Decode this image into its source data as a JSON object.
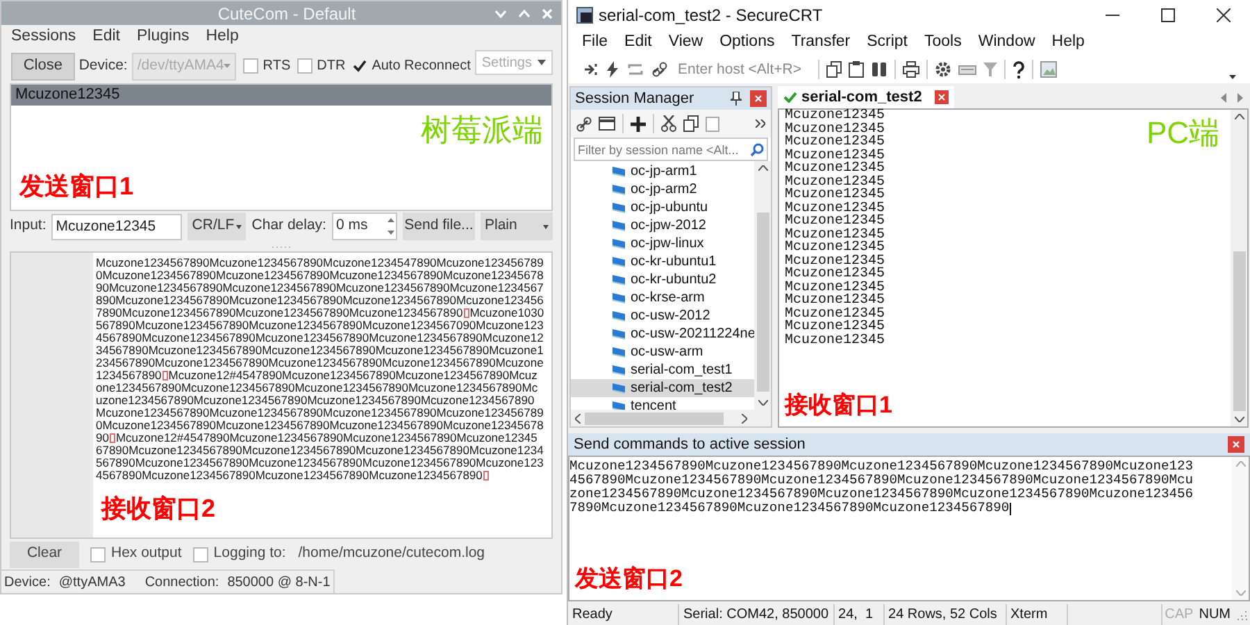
{
  "cutecom": {
    "window": {
      "title": "CuteCom - Default"
    },
    "menu": [
      "Sessions",
      "Edit",
      "Plugins",
      "Help"
    ],
    "toolbar": {
      "close_button": "Close",
      "device_label": "Device:",
      "device": {
        "value": "/dev/ttyAMA4",
        "disabled": true
      },
      "options": [
        {
          "label": "RTS",
          "checked": false
        },
        {
          "label": "DTR",
          "checked": false
        },
        {
          "label": "Auto Reconnect",
          "checked": true
        }
      ],
      "settings_button": "Settings"
    },
    "history": {
      "items": [
        {
          "text": "Mcuzone12345",
          "selected": true
        }
      ],
      "side_label": {
        "text": "树莓派端",
        "color": "#7ed400"
      },
      "area_label": {
        "text": "发送窗口1",
        "color": "#ff0000"
      }
    },
    "input_row": {
      "label": "Input:",
      "value": "Mcuzone12345",
      "line_end": "CR/LF",
      "delay_label": "Char delay:",
      "delay": "0 ms",
      "send_file_button": "Send file...",
      "format": "Plain"
    },
    "output": {
      "lines": [
        [
          {
            "kind": "text",
            "text": "Mcuzone1234567890Mcuzone1234567890Mcuzone1234547890Mcuzone123456789"
          }
        ],
        [
          {
            "kind": "text",
            "text": "0Mcuzone1234567890Mcuzone1234567890Mcuzone1234567890Mcuzone12345678"
          }
        ],
        [
          {
            "kind": "text",
            "text": "90Mcuzone1234567890Mcuzone1234567890Mcuzone1234567890Mcuzone1234567"
          }
        ],
        [
          {
            "kind": "text",
            "text": "890Mcuzone1234567890Mcuzone1234567890Mcuzone1234567890Mcuzone123456"
          }
        ],
        [
          {
            "kind": "text",
            "text": "7890Mcuzone1234567890Mcuzone1234567890Mcuzone1234567890"
          },
          {
            "kind": "missing_glyph"
          },
          {
            "kind": "text",
            "text": "Mcuzone1030"
          }
        ],
        [
          {
            "kind": "text",
            "text": "567890Mcuzone1234567890Mcuzone1234567890Mcuzone1234567090Mcuzone123"
          }
        ],
        [
          {
            "kind": "text",
            "text": "4567890Mcuzone1234567890Mcuzone1234567890Mcuzone1234567890Mcuzone12"
          }
        ],
        [
          {
            "kind": "text",
            "text": "34567890Mcuzone1234567890Mcuzone1234567890Mcuzone1234567890Mcuzone1"
          }
        ],
        [
          {
            "kind": "text",
            "text": "234567890Mcuzone1234567890Mcuzone1234567890Mcuzone1234567890Mcuzone"
          }
        ],
        [
          {
            "kind": "text",
            "text": "1234567890"
          },
          {
            "kind": "missing_glyph"
          },
          {
            "kind": "text",
            "text": "Mcuzone12#4547890Mcuzone1234567890Mcuzone1234567890Mcuz"
          }
        ],
        [
          {
            "kind": "text",
            "text": "one1234567890Mcuzone1234567890Mcuzone1234567890Mcuzone1234567890Mc"
          }
        ],
        [
          {
            "kind": "text",
            "text": "uzone1234567890Mcuzone1234567890Mcuzone1234567890Mcuzone1234567890"
          }
        ],
        [
          {
            "kind": "text",
            "text": "Mcuzone1234567890Mcuzone1234567890Mcuzone1234567890Mcuzone123456789"
          }
        ],
        [
          {
            "kind": "text",
            "text": "0Mcuzone1234567890Mcuzone1234567890Mcuzone1234567890Mcuzone12345678"
          }
        ],
        [
          {
            "kind": "text",
            "text": "90"
          },
          {
            "kind": "missing_glyph"
          },
          {
            "kind": "text",
            "text": "Mcuzone12#4547890Mcuzone1234567890Mcuzone1234567890Mcuzone12345"
          }
        ],
        [
          {
            "kind": "text",
            "text": "67890Mcuzone1234567890Mcuzone1234567890Mcuzone1234567890Mcuzone1234"
          }
        ],
        [
          {
            "kind": "text",
            "text": "567890Mcuzone1234567890Mcuzone1234567890Mcuzone1234567890Mcuzone123"
          }
        ],
        [
          {
            "kind": "text",
            "text": "4567890Mcuzone1234567890Mcuzone1234567890Mcuzone1234567890"
          },
          {
            "kind": "missing_glyph"
          }
        ]
      ],
      "area_label": {
        "text": "接收窗口2",
        "color": "#ff0000"
      }
    },
    "bottom": {
      "clear_button": "Clear",
      "options": [
        {
          "label": "Hex output",
          "checked": false
        },
        {
          "label": "Logging to:",
          "checked": false
        }
      ],
      "log_path": "/home/mcuzone/cutecom.log"
    },
    "status_bar": {
      "device_label": "Device:",
      "device": "@ttyAMA3",
      "connection_label": "Connection:",
      "connection": "850000 @ 8-N-1"
    }
  },
  "securecrt": {
    "window": {
      "title": "serial-com_test2 - SecureCRT"
    },
    "menu": [
      "File",
      "Edit",
      "View",
      "Options",
      "Transfer",
      "Script",
      "Tools",
      "Window",
      "Help"
    ],
    "quick_connect": {
      "placeholder": "Enter host <Alt+R>"
    },
    "session_manager": {
      "title": "Session Manager",
      "filter": {
        "placeholder": "Filter by session name <Alt..."
      },
      "sessions": [
        {
          "name": "oc-jp-arm1",
          "selected": false
        },
        {
          "name": "oc-jp-arm2",
          "selected": false
        },
        {
          "name": "oc-jp-ubuntu",
          "selected": false
        },
        {
          "name": "oc-jpw-2012",
          "selected": false
        },
        {
          "name": "oc-jpw-linux",
          "selected": false
        },
        {
          "name": "oc-kr-ubuntu1",
          "selected": false
        },
        {
          "name": "oc-kr-ubuntu2",
          "selected": false
        },
        {
          "name": "oc-krse-arm",
          "selected": false
        },
        {
          "name": "oc-usw-2012",
          "selected": false
        },
        {
          "name": "oc-usw-20211224ne",
          "selected": false
        },
        {
          "name": "oc-usw-arm",
          "selected": false
        },
        {
          "name": "serial-com_test1",
          "selected": false
        },
        {
          "name": "serial-com_test2",
          "selected": true
        },
        {
          "name": "tencent",
          "selected": false
        }
      ]
    },
    "tabs": [
      {
        "label": "serial-com_test2",
        "selected": true,
        "connected": true
      }
    ],
    "terminal": {
      "lines": [
        "Mcuzone12345",
        "Mcuzone12345",
        "Mcuzone12345",
        "Mcuzone12345",
        "Mcuzone12345",
        "Mcuzone12345",
        "Mcuzone12345",
        "Mcuzone12345",
        "Mcuzone12345",
        "Mcuzone12345",
        "Mcuzone12345",
        "Mcuzone12345",
        "Mcuzone12345",
        "Mcuzone12345",
        "Mcuzone12345",
        "Mcuzone12345",
        "Mcuzone12345",
        "Mcuzone12345"
      ],
      "side_label": {
        "text": "PC端",
        "color": "#7ed400"
      },
      "area_label": {
        "text": "接收窗口1",
        "color": "#ff0000"
      }
    },
    "send_commands": {
      "title": "Send commands to active session",
      "lines": [
        "Mcuzone1234567890Mcuzone1234567890Mcuzone1234567890Mcuzone1234567890Mcuzone123",
        "4567890Mcuzone1234567890Mcuzone1234567890Mcuzone1234567890Mcuzone1234567890Mcu",
        "zone1234567890Mcuzone1234567890Mcuzone1234567890Mcuzone1234567890Mcuzone123456",
        "7890Mcuzone1234567890Mcuzone1234567890Mcuzone1234567890"
      ],
      "area_label": {
        "text": "发送窗口2",
        "color": "#ff0000"
      }
    },
    "status_bar": {
      "fields": [
        "Ready",
        "Serial: COM42, 850000",
        "24,  1",
        "24 Rows, 52 Cols",
        "Xterm"
      ],
      "indicators": [
        {
          "text": "CAP",
          "on": false
        },
        {
          "text": "NUM",
          "on": true
        }
      ]
    }
  }
}
